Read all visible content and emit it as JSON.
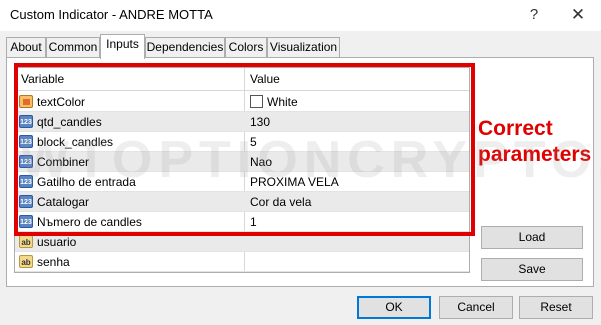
{
  "window": {
    "title": "Custom Indicator - ANDRE MOTTA",
    "help_label": "?",
    "close_label": "✕"
  },
  "tabs": [
    {
      "label": "About"
    },
    {
      "label": "Common"
    },
    {
      "label": "Inputs"
    },
    {
      "label": "Dependencies"
    },
    {
      "label": "Colors"
    },
    {
      "label": "Visualization"
    }
  ],
  "grid": {
    "header": {
      "variable": "Variable",
      "value": "Value"
    },
    "rows": [
      {
        "icon": "color-icon",
        "name": "textColor",
        "value": "White"
      },
      {
        "icon": "number-icon",
        "name": "qtd_candles",
        "value": "130"
      },
      {
        "icon": "number-icon",
        "name": "block_candles",
        "value": "5"
      },
      {
        "icon": "number-icon",
        "name": "Combiner",
        "value": "Nao"
      },
      {
        "icon": "number-icon",
        "name": "Gatilho de entrada",
        "value": "PROXIMA VELA"
      },
      {
        "icon": "number-icon",
        "name": "Catalogar",
        "value": "Cor da vela"
      },
      {
        "icon": "number-icon",
        "name": "Nъmero de candles",
        "value": "1"
      },
      {
        "icon": "string-icon",
        "name": "usuario",
        "value": ""
      },
      {
        "icon": "string-icon",
        "name": "senha",
        "value": ""
      }
    ]
  },
  "annotation": {
    "line1": "Correct",
    "line2": "parameters"
  },
  "watermark": "WTOPTIONCRYPTO.COM",
  "side_buttons": {
    "load": "Load",
    "save": "Save"
  },
  "footer": {
    "ok": "OK",
    "cancel": "Cancel",
    "reset": "Reset"
  },
  "colors": {
    "highlight": "#e00000",
    "swatch_white": "#ffffff"
  }
}
